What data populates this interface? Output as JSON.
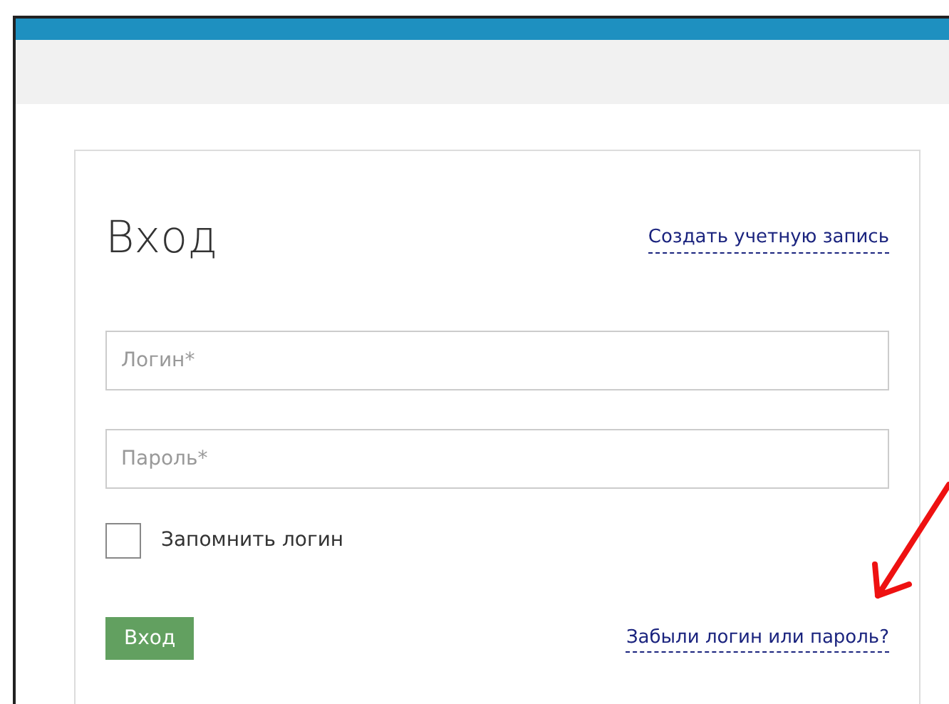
{
  "login_form": {
    "title": "Вход",
    "create_account_link": "Создать учетную запись",
    "fields": [
      {
        "placeholder": "Логин*"
      },
      {
        "placeholder": "Пароль*"
      }
    ],
    "remember": {
      "label": "Запомнить логин",
      "checked": false
    },
    "submit_button": "Вход",
    "forgot_link": "Забыли логин или пароль?"
  }
}
